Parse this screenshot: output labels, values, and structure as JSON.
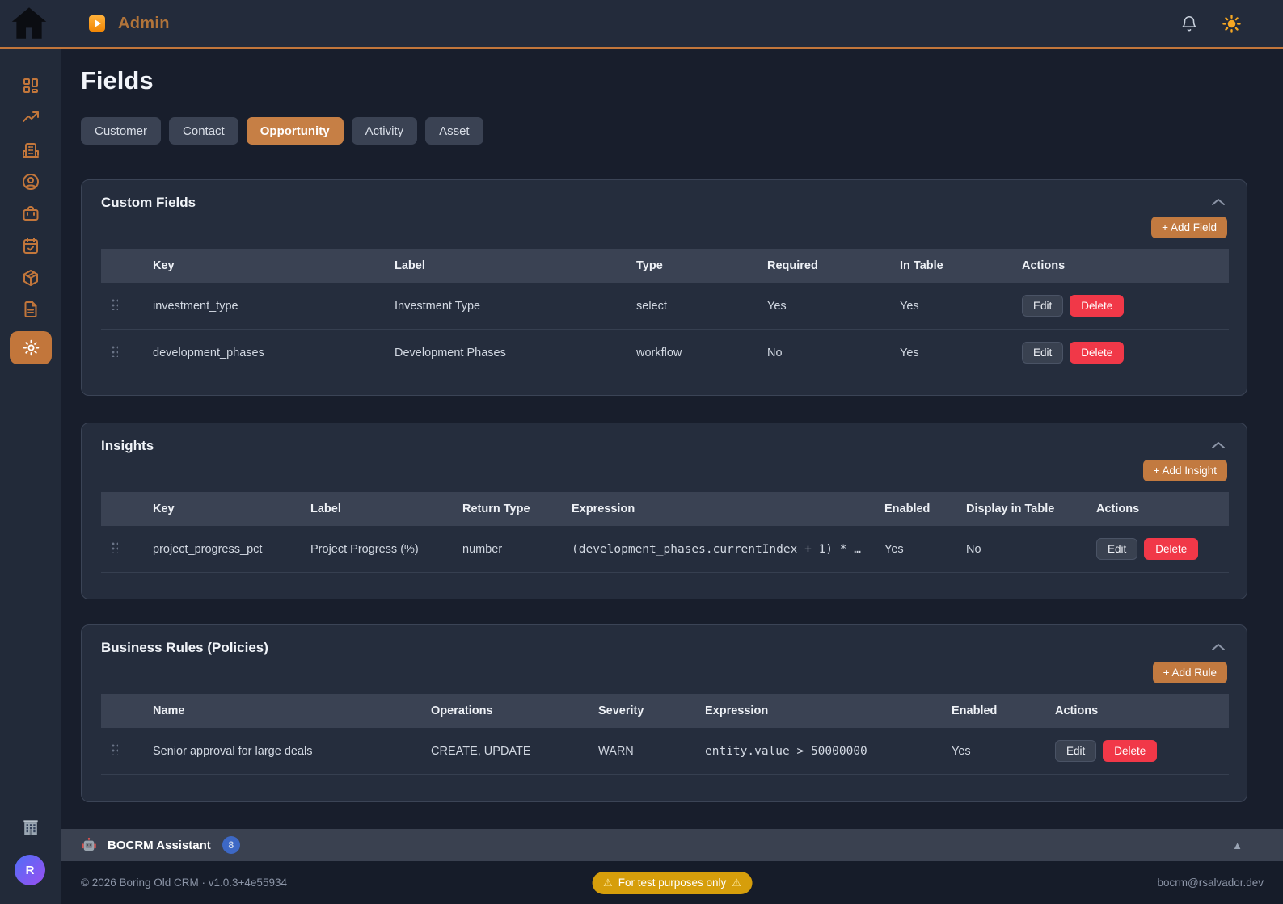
{
  "topbar": {
    "app_title": "Admin",
    "icons": {
      "home": "home-icon",
      "app": "play-icon",
      "notifications": "bell-icon",
      "theme": "sun-icon"
    }
  },
  "sidebar": {
    "items": [
      {
        "icon": "dashboard-icon",
        "active": false
      },
      {
        "icon": "trending-up-icon",
        "active": false
      },
      {
        "icon": "building-icon",
        "active": false
      },
      {
        "icon": "user-circle-icon",
        "active": false
      },
      {
        "icon": "briefcase-icon",
        "active": false
      },
      {
        "icon": "calendar-check-icon",
        "active": false
      },
      {
        "icon": "package-icon",
        "active": false
      },
      {
        "icon": "file-text-icon",
        "active": false
      },
      {
        "icon": "gear-icon",
        "active": true
      }
    ],
    "bottom": {
      "office_icon": "office-building-icon",
      "avatar_letter": "R"
    }
  },
  "page": {
    "title": "Fields",
    "tabs": [
      {
        "label": "Customer",
        "active": false
      },
      {
        "label": "Contact",
        "active": false
      },
      {
        "label": "Opportunity",
        "active": true
      },
      {
        "label": "Activity",
        "active": false
      },
      {
        "label": "Asset",
        "active": false
      }
    ]
  },
  "labels": {
    "edit": "Edit",
    "delete": "Delete"
  },
  "sections": {
    "custom_fields": {
      "title": "Custom Fields",
      "add_label": "+ Add Field",
      "columns": [
        "Key",
        "Label",
        "Type",
        "Required",
        "In Table",
        "Actions"
      ],
      "rows": [
        {
          "key": "investment_type",
          "label": "Investment Type",
          "type": "select",
          "required": "Yes",
          "in_table": "Yes"
        },
        {
          "key": "development_phases",
          "label": "Development Phases",
          "type": "workflow",
          "required": "No",
          "in_table": "Yes"
        }
      ]
    },
    "insights": {
      "title": "Insights",
      "add_label": "+ Add Insight",
      "columns": [
        "Key",
        "Label",
        "Return Type",
        "Expression",
        "Enabled",
        "Display in Table",
        "Actions"
      ],
      "rows": [
        {
          "key": "project_progress_pct",
          "label": "Project Progress (%)",
          "return_type": "number",
          "expression": "(development_phases.currentIndex + 1) * …",
          "enabled": "Yes",
          "display_in_table": "No"
        }
      ]
    },
    "business_rules": {
      "title": "Business Rules (Policies)",
      "add_label": "+ Add Rule",
      "columns": [
        "Name",
        "Operations",
        "Severity",
        "Expression",
        "Enabled",
        "Actions"
      ],
      "rows": [
        {
          "name": "Senior approval for large deals",
          "operations": "CREATE, UPDATE",
          "severity": "WARN",
          "expression": "entity.value > 50000000",
          "enabled": "Yes"
        }
      ]
    }
  },
  "assistant": {
    "label": "BOCRM Assistant",
    "badge": "8",
    "collapse_icon": "▲"
  },
  "footer": {
    "copyright": "© 2026 Boring Old CRM · v1.0.3+4e55934",
    "warning_icon": "⚠",
    "warning_badge": "For test purposes only",
    "email": "bocrm@rsalvador.dev"
  },
  "colors": {
    "accent_orange": "#c2763b",
    "active_tab": "#c67f45",
    "danger_red": "#f13848",
    "warn_amber": "#eca823",
    "footer_badge_amber": "#d69e0b",
    "assistant_badge_blue": "#3d68c5",
    "card_bg": "#252d3d",
    "page_bg": "#181e2c"
  }
}
